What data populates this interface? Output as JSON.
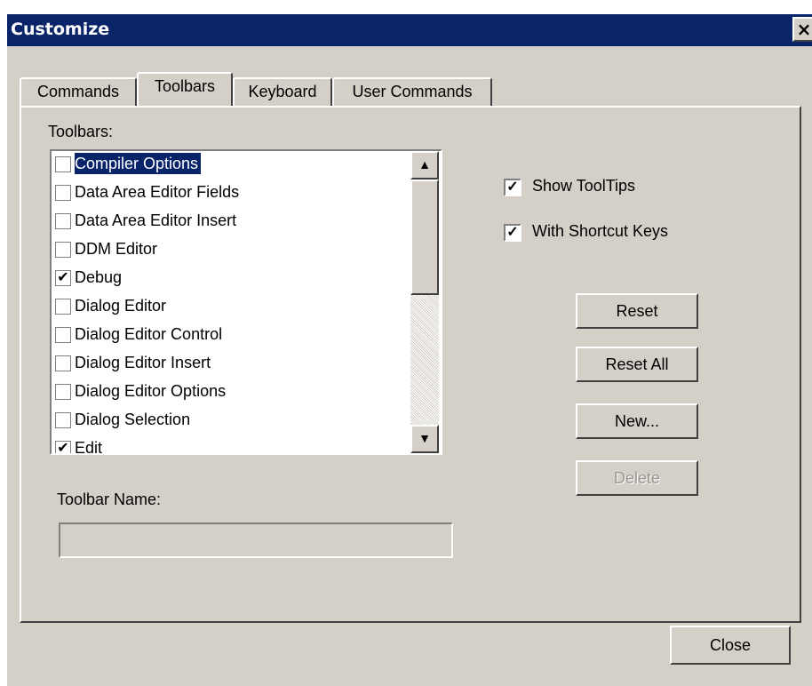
{
  "window": {
    "title": "Customize",
    "close_label": "×"
  },
  "tabs": [
    {
      "label": "Commands",
      "active": false
    },
    {
      "label": "Toolbars",
      "active": true
    },
    {
      "label": "Keyboard",
      "active": false
    },
    {
      "label": "User Commands",
      "active": false
    }
  ],
  "toolbars_panel": {
    "list_label": "Toolbars:",
    "items": [
      {
        "label": "Compiler Options",
        "checked": false,
        "selected": true
      },
      {
        "label": "Data Area Editor Fields",
        "checked": false,
        "selected": false
      },
      {
        "label": "Data Area Editor Insert",
        "checked": false,
        "selected": false
      },
      {
        "label": "DDM Editor",
        "checked": false,
        "selected": false
      },
      {
        "label": "Debug",
        "checked": true,
        "selected": false
      },
      {
        "label": "Dialog Editor",
        "checked": false,
        "selected": false
      },
      {
        "label": "Dialog Editor Control",
        "checked": false,
        "selected": false
      },
      {
        "label": "Dialog Editor Insert",
        "checked": false,
        "selected": false
      },
      {
        "label": "Dialog Editor Options",
        "checked": false,
        "selected": false
      },
      {
        "label": "Dialog Selection",
        "checked": false,
        "selected": false
      },
      {
        "label": "Edit",
        "checked": true,
        "selected": false
      }
    ],
    "toolbar_name_label": "Toolbar Name:",
    "toolbar_name_value": ""
  },
  "options": {
    "show_tooltips": {
      "label": "Show ToolTips",
      "checked": true
    },
    "with_shortcut_keys": {
      "label": "With Shortcut Keys",
      "checked": true
    }
  },
  "buttons": {
    "reset": "Reset",
    "reset_all": "Reset All",
    "new": "New...",
    "delete": "Delete",
    "close": "Close"
  },
  "colors": {
    "titlebar": "#0a246a",
    "dialog_bg": "#d4d0c8",
    "selection": "#0a246a"
  }
}
